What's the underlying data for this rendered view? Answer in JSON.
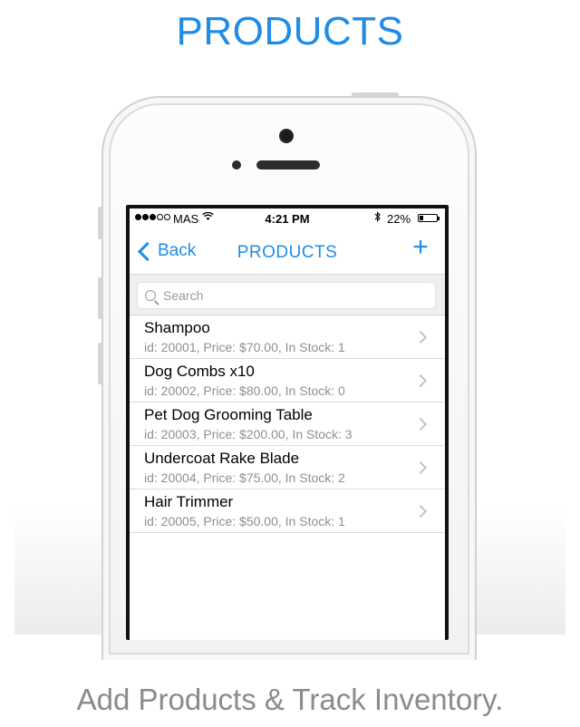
{
  "header": {
    "title": "PRODUCTS"
  },
  "footer": {
    "tagline": "Add Products & Track Inventory."
  },
  "status_bar": {
    "carrier": "MAS",
    "time": "4:21 PM",
    "battery": "22%",
    "battery_level": 0.22,
    "signal_bars_filled": 3,
    "signal_bars_total": 5
  },
  "navbar": {
    "back_label": "Back",
    "title": "PRODUCTS",
    "add_label": "+"
  },
  "search": {
    "placeholder": "Search"
  },
  "products": [
    {
      "name": "Shampoo",
      "details": "id: 20001, Price: $70.00, In Stock: 1"
    },
    {
      "name": "Dog Combs x10",
      "details": "id: 20002, Price: $80.00, In Stock: 0"
    },
    {
      "name": "Pet Dog Grooming Table",
      "details": "id: 20003, Price: $200.00, In Stock: 3"
    },
    {
      "name": "Undercoat Rake Blade",
      "details": "id: 20004, Price: $75.00, In Stock: 2"
    },
    {
      "name": "Hair Trimmer",
      "details": "id: 20005, Price: $50.00, In Stock: 1"
    }
  ],
  "colors": {
    "accent": "#1f8ce6",
    "tagline": "#8b8b8b"
  }
}
